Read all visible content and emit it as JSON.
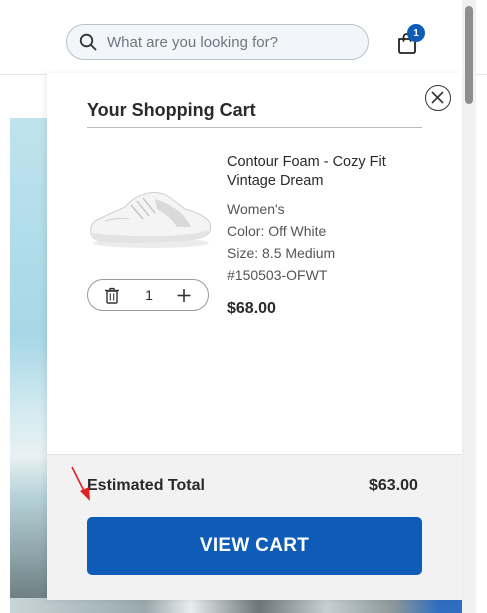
{
  "header": {
    "search": {
      "placeholder": "What are you looking for?",
      "value": "",
      "icon": "search-icon"
    },
    "cart": {
      "icon": "shopping-bag-icon",
      "count": "1",
      "badge_color": "#0f5cb8"
    }
  },
  "cart_drawer": {
    "title": "Your Shopping Cart",
    "close_icon": "close-icon",
    "item": {
      "image_icon": "white-sneaker-image",
      "name": "Contour Foam - Cozy Fit Vintage Dream",
      "gender": "Women's",
      "color": "Color: Off White",
      "size": "Size: 8.5 Medium",
      "sku": "#150503-OFWT",
      "price": "$68.00",
      "quantity": "1",
      "remove_icon": "trash-icon",
      "increase_icon": "plus-icon"
    },
    "footer": {
      "estimated_total_label": "Estimated Total",
      "estimated_total_value": "$63.00",
      "view_cart_label": "VIEW CART",
      "button_color": "#0f5cb8"
    }
  },
  "annotation": {
    "icon": "red-arrow-pointer",
    "color": "#e02020"
  }
}
